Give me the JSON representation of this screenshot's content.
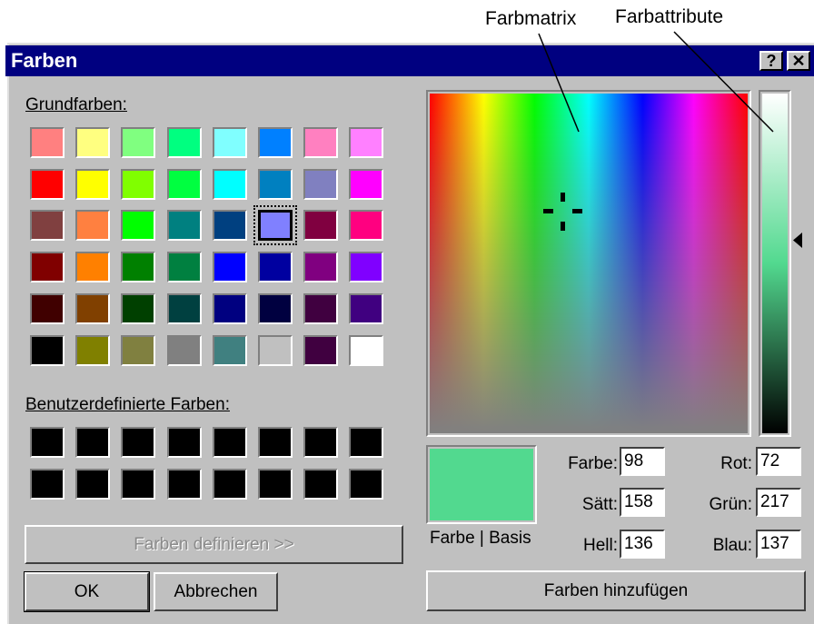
{
  "annotations": {
    "farbmatrix": "Farbmatrix",
    "farbattribute": "Farbattribute"
  },
  "window": {
    "title": "Farben",
    "help_label": "?",
    "close_label": "✕"
  },
  "basic_colors": {
    "label": "Grundfarben:",
    "selected_index": 21,
    "colors": [
      "#ff8080",
      "#ffff80",
      "#80ff80",
      "#00ff80",
      "#80ffff",
      "#0080ff",
      "#ff80c0",
      "#ff80ff",
      "#ff0000",
      "#ffff00",
      "#80ff00",
      "#00ff40",
      "#00ffff",
      "#0080c0",
      "#8080c0",
      "#ff00ff",
      "#804040",
      "#ff8040",
      "#00ff00",
      "#008080",
      "#004080",
      "#8080ff",
      "#800040",
      "#ff0080",
      "#800000",
      "#ff8000",
      "#008000",
      "#008040",
      "#0000ff",
      "#0000a0",
      "#800080",
      "#8000ff",
      "#400000",
      "#804000",
      "#004000",
      "#004040",
      "#000080",
      "#000040",
      "#400040",
      "#400080",
      "#000000",
      "#808000",
      "#808040",
      "#808080",
      "#408080",
      "#c0c0c0",
      "#400040",
      "#ffffff"
    ]
  },
  "custom_colors": {
    "label": "Benutzerdefinierte Farben:",
    "colors": [
      "#000000",
      "#000000",
      "#000000",
      "#000000",
      "#000000",
      "#000000",
      "#000000",
      "#000000",
      "#000000",
      "#000000",
      "#000000",
      "#000000",
      "#000000",
      "#000000",
      "#000000",
      "#000000"
    ]
  },
  "buttons": {
    "define": "Farben definieren >>",
    "ok": "OK",
    "cancel": "Abbrechen",
    "add": "Farben hinzufügen"
  },
  "preview": {
    "color": "#52d98f",
    "label": "Farbe | Basis"
  },
  "fields": {
    "farbe": {
      "label": "Farbe:",
      "value": "98"
    },
    "saett": {
      "label": "Sätt:",
      "value": "158"
    },
    "hell": {
      "label": "Hell:",
      "value": "136"
    },
    "rot": {
      "label": "Rot:",
      "value": "72"
    },
    "gruen": {
      "label": "Grün:",
      "value": "217"
    },
    "blau": {
      "label": "Blau:",
      "value": "137"
    }
  },
  "colors": {
    "face": "#c0c0c0",
    "titlebar": "#000080"
  }
}
